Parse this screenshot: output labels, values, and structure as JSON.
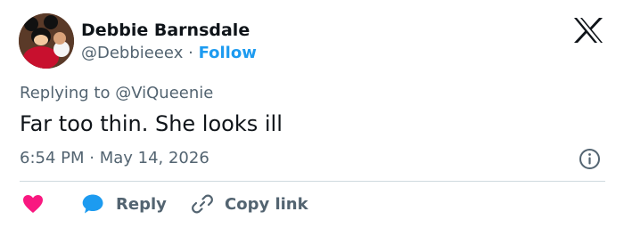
{
  "author": {
    "name": "Debbie Barnsdale",
    "handle": "@Debbieeex",
    "separator": "·",
    "follow_label": "Follow"
  },
  "tweet": {
    "replying_prefix": "Replying to",
    "replying_to": "@ViQueenie",
    "text": "Far too thin. She looks ill",
    "timestamp": "6:54 PM · May 14, 2026"
  },
  "actions": {
    "reply_label": "Reply",
    "copy_label": "Copy link"
  },
  "icons": {
    "logo": "x-logo-icon",
    "info": "info-icon",
    "heart": "heart-icon",
    "reply": "reply-bubble-icon",
    "link": "link-icon"
  },
  "colors": {
    "link_blue": "#1d9bf0",
    "heart_pink": "#f91880",
    "secondary_text": "#536471",
    "primary_text": "#0f1419",
    "divider": "#cfd9de"
  }
}
